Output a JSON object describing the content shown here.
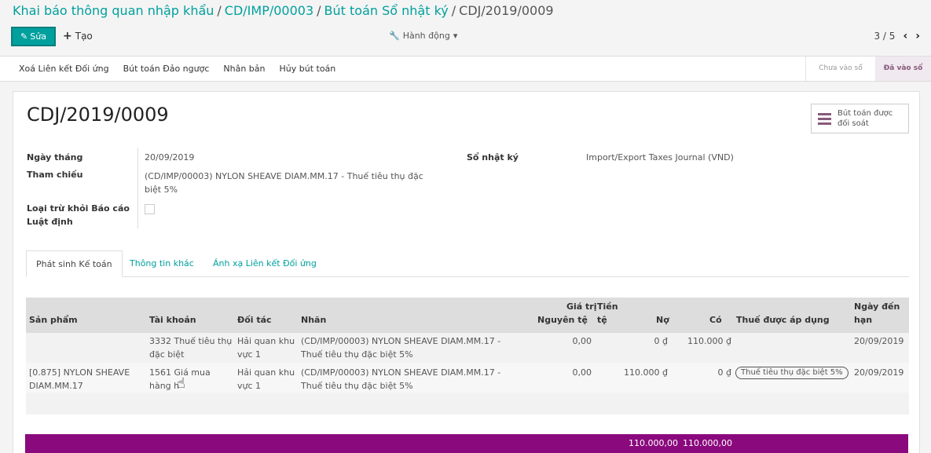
{
  "breadcrumb": {
    "level1": "Khai báo thông quan nhập khẩu",
    "level2": "CD/IMP/00003",
    "level3": "Bút toán Sổ nhật ký",
    "current": "CDJ/2019/0009",
    "separator": "/"
  },
  "toolbar": {
    "edit_label": "Sửa",
    "create_label": "Tạo",
    "action_label": "Hành động",
    "pager": "3 / 5"
  },
  "statusbar": {
    "buttons": [
      "Xoá Liên kết Đối ứng",
      "Bút toán Đảo ngược",
      "Nhân bản",
      "Hủy bút toán"
    ],
    "stage_draft": "Chưa vào sổ",
    "stage_posted": "Đã vào sổ"
  },
  "form": {
    "title": "CDJ/2019/0009",
    "smart_button": {
      "line1": "Bút toán được",
      "line2": "đối soát"
    },
    "date_label": "Ngày tháng",
    "date_value": "20/09/2019",
    "ref_label": "Tham chiếu",
    "ref_value_line1": "(CD/IMP/00003) NYLON SHEAVE DIAM.MM.17 - Thuế tiêu thụ đặc",
    "ref_value_line2": "biệt 5%",
    "exclude_label_line1": "Loại trừ khỏi Báo cáo",
    "exclude_label_line2": "Luật định",
    "journal_label": "Sổ nhật ký",
    "journal_value": "Import/Export Taxes Journal (VND)"
  },
  "tabs": [
    "Phát sinh Kế toán",
    "Thông tin khác",
    "Ánh xạ Liên kết Đối ứng"
  ],
  "table": {
    "headers": {
      "product": "Sản phẩm",
      "account": "Tài khoản",
      "partner": "Đối tác",
      "label": "Nhãn",
      "amount_currency_1": "Giá trị",
      "amount_currency_2": "Nguyên tệ",
      "currency_1": "Tiền",
      "currency_2": "tệ",
      "debit": "Nợ",
      "credit": "Có",
      "taxes": "Thuế được áp dụng",
      "due_1": "Ngày đến",
      "due_2": "hạn"
    },
    "rows": [
      {
        "product_1": "",
        "product_2": "",
        "account_1": "3332 Thuế tiêu thụ",
        "account_2": "đặc biệt",
        "partner_1": "Hải quan khu",
        "partner_2": "vực 1",
        "label_1": "(CD/IMP/00003) NYLON SHEAVE DIAM.MM.17 -",
        "label_2": "Thuế tiêu thụ đặc biệt 5%",
        "amount_currency": "0,00",
        "debit": "0 ₫",
        "credit": "110.000 ₫",
        "tax": "",
        "due": "20/09/2019"
      },
      {
        "product_1": "[0.875] NYLON SHEAVE",
        "product_2": "DIAM.MM.17",
        "account_1": "1561 Giá mua",
        "account_2": "hàng h",
        "partner_1": "Hải quan khu",
        "partner_2": "vực 1",
        "label_1": "(CD/IMP/00003) NYLON SHEAVE DIAM.MM.17 -",
        "label_2": "Thuế tiêu thụ đặc biệt 5%",
        "amount_currency": "0,00",
        "debit": "110.000 ₫",
        "credit": "0 ₫",
        "tax": "Thuế tiêu thụ đặc biệt 5%",
        "due": "20/09/2019"
      }
    ],
    "totals": {
      "debit": "110.000,00",
      "credit": "110.000,00"
    }
  },
  "colors": {
    "primary": "#00a09d",
    "brand": "#875a7b",
    "totals_bar": "#8a0a7e"
  }
}
